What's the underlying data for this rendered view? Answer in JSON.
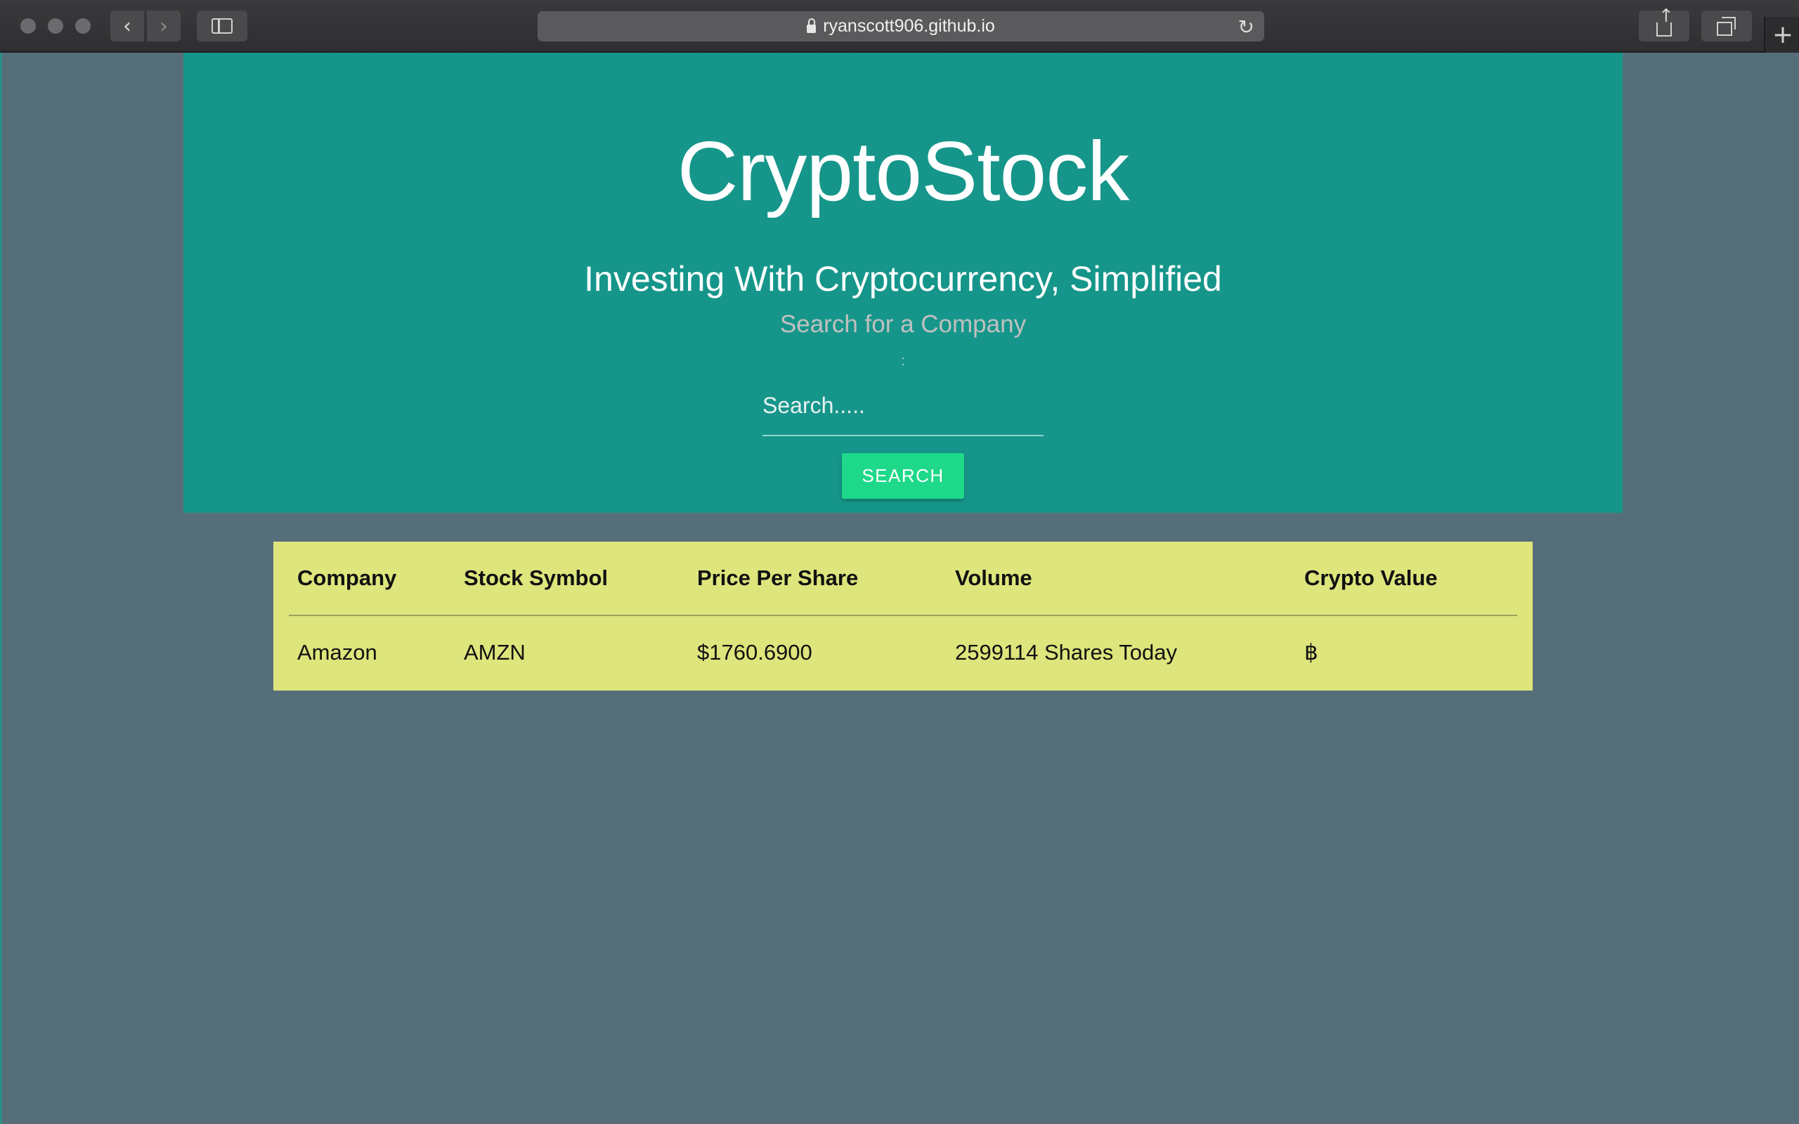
{
  "browser": {
    "url": "ryanscott906.github.io",
    "icons": {
      "back": "chevron-left-icon",
      "forward": "chevron-right-icon",
      "sidebar": "sidebar-icon",
      "lock": "lock-icon",
      "reload": "reload-icon",
      "share": "share-icon",
      "tabs": "tabs-icon",
      "new_tab": "plus-icon"
    }
  },
  "hero": {
    "title": "CryptoStock",
    "subtitle": "Investing With Cryptocurrency, Simplified",
    "search_label": "Search for a Company",
    "separator": ":",
    "search_placeholder": "Search.....",
    "search_button": "SEARCH",
    "background_color": "#16968a",
    "button_color": "#1ed98a"
  },
  "results": {
    "background_color": "#dde57c",
    "columns": [
      "Company",
      "Stock Symbol",
      "Price Per Share",
      "Volume",
      "Crypto Value"
    ],
    "rows": [
      [
        "Amazon",
        "AMZN",
        "$1760.6900",
        "2599114 Shares Today",
        "฿"
      ]
    ]
  },
  "page": {
    "background_color": "#566e7a"
  }
}
